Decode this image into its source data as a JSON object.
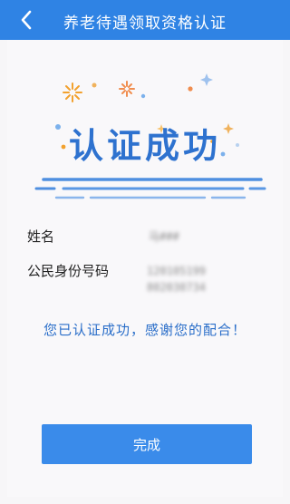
{
  "header": {
    "title": "养老待遇领取资格认证",
    "back_icon": "chevron-left-icon"
  },
  "hero": {
    "headline": "认证成功",
    "decor_icons": [
      "firework-icon",
      "sparkle-icon"
    ]
  },
  "fields": [
    {
      "label": "姓名",
      "value": "马###"
    },
    {
      "label": "公民身份号码",
      "value": "120105199802030734"
    }
  ],
  "message": "您已认证成功，感谢您的配合！",
  "footer": {
    "done_label": "完成"
  },
  "colors": {
    "brand_blue": "#2f83e4",
    "headline_blue": "#2e72cf",
    "button_blue": "#3a8bea"
  }
}
